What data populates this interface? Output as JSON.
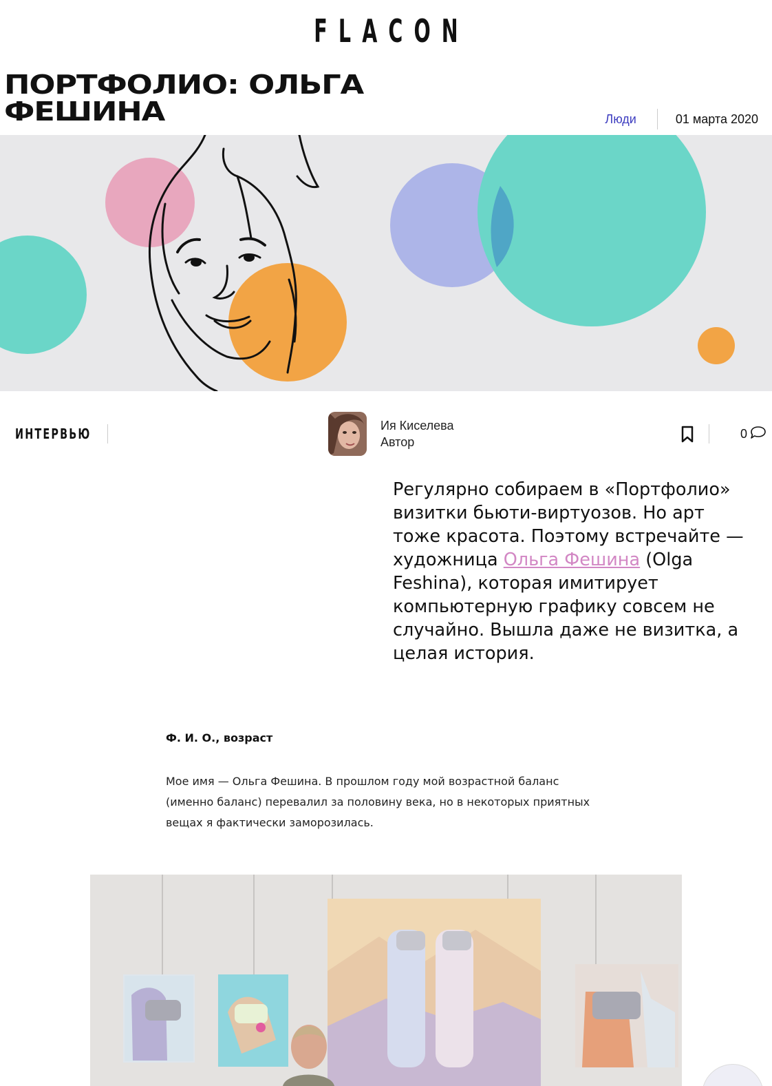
{
  "site": {
    "logo": "FLACON"
  },
  "article": {
    "title": "Портфолио: Ольга Фешина",
    "category": "Люди",
    "date": "01 марта 2020",
    "rubric": "ИНТЕРВЬЮ",
    "author": {
      "name": "Ия Киселева",
      "role": "Автор"
    },
    "comments_count": "0",
    "lead": {
      "before_link": "Регулярно собираем в «Портфолио» визитки бьюти-виртуозов. Но арт тоже красота. Поэтому встречайте — художница ",
      "link_text": "Ольга Фешина",
      "after_link": " (Olga Feshina), которая имитирует компьютерную графику совсем не случайно. Вышла даже не визитка, а целая история."
    },
    "sections": [
      {
        "question": "Ф. И. О., возраст",
        "answer": "Мое имя — Ольга Фешина. В прошлом году мой возрастной баланс (именно баланс) перевалил за половину века, но в некоторых приятных вещах я фактически заморозилась."
      }
    ]
  },
  "colors": {
    "accent_link": "#d287c4",
    "category": "#3e3ec0",
    "teal": "#6bd6c8",
    "pink": "#e8a7be",
    "orange": "#f2a445",
    "lavender": "#adb5e8"
  },
  "icons": {
    "bookmark": "bookmark-icon",
    "comments": "comment-bubble-icon"
  }
}
